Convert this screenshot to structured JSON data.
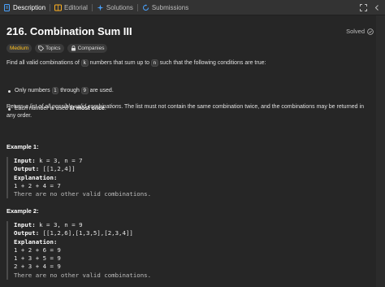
{
  "tabs": [
    {
      "label": "Description",
      "icon": "description-icon"
    },
    {
      "label": "Editorial",
      "icon": "editorial-icon"
    },
    {
      "label": "Solutions",
      "icon": "solutions-icon"
    },
    {
      "label": "Submissions",
      "icon": "submissions-icon"
    }
  ],
  "problem": {
    "title": "216. Combination Sum III",
    "status": "Solved",
    "difficulty": "Medium",
    "difficulty_color": "#ffc01e",
    "topics_label": "Topics",
    "companies_label": "Companies"
  },
  "statement": {
    "intro_a": "Find all valid combinations of ",
    "intro_k": "k",
    "intro_b": " numbers that sum up to ",
    "intro_n": "n",
    "intro_c": " such that the following conditions are true:",
    "b1_a": "Only numbers ",
    "b1_1": "1",
    "b1_b": " through ",
    "b1_9": "9",
    "b1_c": " are used.",
    "b2_a": "Each number is used ",
    "b2_bold": "at most once",
    "b2_c": ".",
    "ret_a": "Return ",
    "ret_it": "a list of all possible valid combinations",
    "ret_b": ". The list must not contain the same combination twice, and the combinations may be returned in any order."
  },
  "examples": [
    {
      "title": "Example 1:",
      "input_label": "Input:",
      "input": " k = 3, n = 7",
      "output_label": "Output:",
      "output": " [[1,2,4]]",
      "explanation_label": "Explanation:",
      "lines": [
        "1 + 2 + 4 = 7",
        "There are no other valid combinations."
      ]
    },
    {
      "title": "Example 2:",
      "input_label": "Input:",
      "input": " k = 3, n = 9",
      "output_label": "Output:",
      "output": " [[1,2,6],[1,3,5],[2,3,4]]",
      "explanation_label": "Explanation:",
      "lines": [
        "1 + 2 + 6 = 9",
        "1 + 3 + 5 = 9",
        "2 + 3 + 4 = 9",
        "There are no other valid combinations."
      ]
    }
  ]
}
